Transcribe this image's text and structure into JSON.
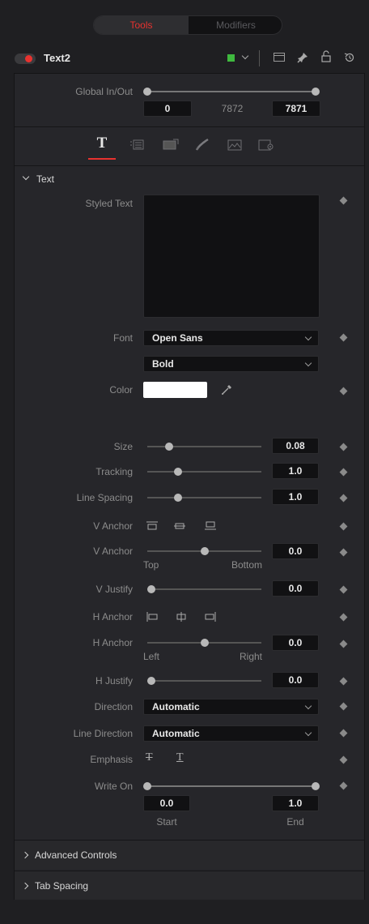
{
  "tabs": {
    "tools": "Tools",
    "modifiers": "Modifiers"
  },
  "node": {
    "name": "Text2"
  },
  "global": {
    "label": "Global In/Out",
    "in": "0",
    "mid": "7872",
    "out": "7871",
    "in_fraction": 0.0,
    "out_fraction": 1.0
  },
  "section_text": "Text",
  "styled_text": {
    "label": "Styled Text",
    "value": ""
  },
  "font": {
    "label": "Font",
    "family": "Open Sans",
    "style": "Bold"
  },
  "color": {
    "label": "Color",
    "value": "#ffffff"
  },
  "size": {
    "label": "Size",
    "value": "0.08",
    "fraction": 0.17
  },
  "tracking": {
    "label": "Tracking",
    "value": "1.0",
    "fraction": 0.25
  },
  "line_spacing": {
    "label": "Line Spacing",
    "value": "1.0",
    "fraction": 0.25
  },
  "v_anchor_buttons": {
    "label": "V Anchor"
  },
  "v_anchor": {
    "label": "V Anchor",
    "value": "0.0",
    "fraction": 0.5,
    "left": "Top",
    "right": "Bottom"
  },
  "v_justify": {
    "label": "V Justify",
    "value": "0.0",
    "fraction": 0.0
  },
  "h_anchor_buttons": {
    "label": "H Anchor"
  },
  "h_anchor": {
    "label": "H Anchor",
    "value": "0.0",
    "fraction": 0.5,
    "left": "Left",
    "right": "Right"
  },
  "h_justify": {
    "label": "H Justify",
    "value": "0.0",
    "fraction": 0.0
  },
  "direction": {
    "label": "Direction",
    "value": "Automatic"
  },
  "line_direction": {
    "label": "Line Direction",
    "value": "Automatic"
  },
  "emphasis": {
    "label": "Emphasis"
  },
  "write_on": {
    "label": "Write On",
    "start": "0.0",
    "end": "1.0",
    "start_label": "Start",
    "end_label": "End",
    "start_fraction": 0.0,
    "end_fraction": 1.0
  },
  "advanced": "Advanced Controls",
  "tab_spacing": "Tab Spacing",
  "colors": {
    "accent": "#e8322f",
    "node_swatch": "#3fb93f",
    "knob": "#b8b8b8"
  }
}
